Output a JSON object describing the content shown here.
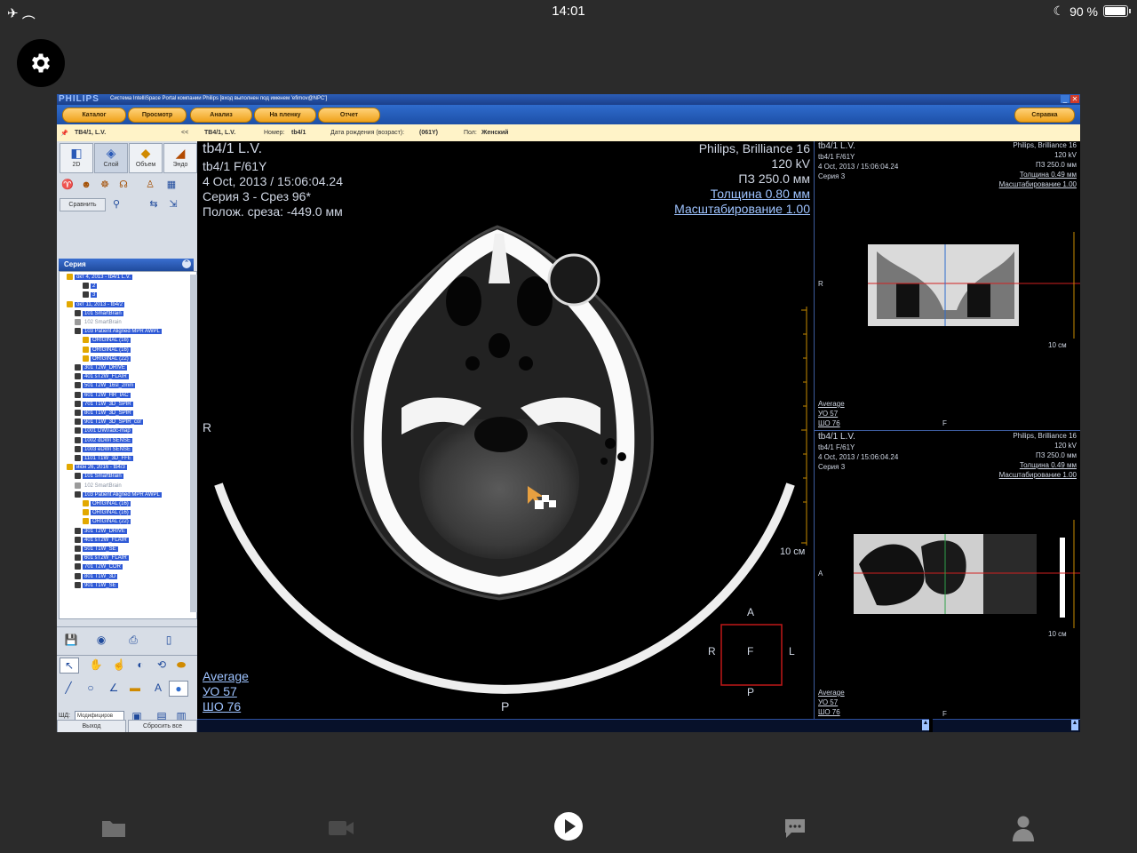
{
  "status_bar": {
    "time": "14:01",
    "battery": "90 %"
  },
  "app": {
    "brand": "PHILIPS",
    "window_title": "Система IntelliSpace Portal компании Philips [вход выполнен под именем 'efimov@NPC']",
    "menu": [
      "Каталог",
      "Просмотр",
      "Анализ",
      "На пленку",
      "Отчет"
    ],
    "help_label": "Справка",
    "info": {
      "patient_tab": "ТВ4/1, L.V.",
      "patient": "ТВ4/1, L.V.",
      "number_label": "Номер:",
      "number": "tb4/1",
      "dob_label": "Дата рождения (возраст):",
      "dob": "(061Y)",
      "sex_label": "Пол:",
      "sex": "Женский"
    },
    "tools": {
      "b2d": "2D",
      "slab": "Слой",
      "volume": "Объем",
      "endo": "Эндо",
      "compare": "Сравнить"
    },
    "series_header": "Серия",
    "series_tree": [
      {
        "label": "окт 4, 2013 - tb4/1 L.V.",
        "indent": 0,
        "dim": false,
        "icon": "#e2a800"
      },
      {
        "label": "2",
        "indent": 2,
        "dim": false,
        "icon": "#3a3a3a"
      },
      {
        "label": "3",
        "indent": 2,
        "dim": false,
        "icon": "#3a3a3a"
      },
      {
        "label": "окт 11, 2013 - tb4/2",
        "indent": 0,
        "dim": false,
        "icon": "#e2a800"
      },
      {
        "label": "101  SmartBrain",
        "indent": 1,
        "dim": false,
        "icon": "#3a3a3a"
      },
      {
        "label": "102  SmartBrain",
        "indent": 1,
        "dim": true,
        "icon": "#9a9a9a"
      },
      {
        "label": "103  Patient Aligned MPR AWPL",
        "indent": 1,
        "dim": false,
        "icon": "#3a3a3a"
      },
      {
        "label": "ORIGINAL (16)",
        "indent": 2,
        "dim": false,
        "icon": "#e2a800"
      },
      {
        "label": "ORIGINAL (16)",
        "indent": 2,
        "dim": false,
        "icon": "#e2a800"
      },
      {
        "label": "ORIGINAL (22)",
        "indent": 2,
        "dim": false,
        "icon": "#e2a800"
      },
      {
        "label": "301  T2W_DRIVE",
        "indent": 1,
        "dim": false,
        "icon": "#3a3a3a"
      },
      {
        "label": "401  sT2W_FLAIR",
        "indent": 1,
        "dim": false,
        "icon": "#3a3a3a"
      },
      {
        "label": "501  T2W_16sl_2mm",
        "indent": 1,
        "dim": false,
        "icon": "#3a3a3a"
      },
      {
        "label": "601  T2W_HR_IAC",
        "indent": 1,
        "dim": false,
        "icon": "#3a3a3a"
      },
      {
        "label": "701  T1W_3D_SPIR",
        "indent": 1,
        "dim": false,
        "icon": "#3a3a3a"
      },
      {
        "label": "801  T1W_3D_SPIR",
        "indent": 1,
        "dim": false,
        "icon": "#3a3a3a"
      },
      {
        "label": "901  T1W_3D_SPIR_cor",
        "indent": 1,
        "dim": false,
        "icon": "#3a3a3a"
      },
      {
        "label": "1001  DWI/adc-map",
        "indent": 1,
        "dim": false,
        "icon": "#3a3a3a"
      },
      {
        "label": "1002  dDWI SENSE",
        "indent": 1,
        "dim": false,
        "icon": "#3a3a3a"
      },
      {
        "label": "1003  eDWI SENSE",
        "indent": 1,
        "dim": false,
        "icon": "#3a3a3a"
      },
      {
        "label": "1101  T1W_3D_FFE",
        "indent": 1,
        "dim": false,
        "icon": "#3a3a3a"
      },
      {
        "label": "июн 26, 2016 - tb4/3",
        "indent": 0,
        "dim": false,
        "icon": "#e2a800"
      },
      {
        "label": "101  SmartBrain",
        "indent": 1,
        "dim": false,
        "icon": "#3a3a3a"
      },
      {
        "label": "102  SmartBrain",
        "indent": 1,
        "dim": true,
        "icon": "#9a9a9a"
      },
      {
        "label": "103  Patient Aligned MPR AWPL",
        "indent": 1,
        "dim": false,
        "icon": "#3a3a3a"
      },
      {
        "label": "ORIGINAL (16)",
        "indent": 2,
        "dim": false,
        "icon": "#e2a800"
      },
      {
        "label": "ORIGINAL (16)",
        "indent": 2,
        "dim": false,
        "icon": "#e2a800"
      },
      {
        "label": "ORIGINAL (22)",
        "indent": 2,
        "dim": false,
        "icon": "#e2a800"
      },
      {
        "label": "301  T2W_DRIVE",
        "indent": 1,
        "dim": false,
        "icon": "#3a3a3a"
      },
      {
        "label": "401  sT2W_FLAIR",
        "indent": 1,
        "dim": false,
        "icon": "#3a3a3a"
      },
      {
        "label": "501  T1W_SE",
        "indent": 1,
        "dim": false,
        "icon": "#3a3a3a"
      },
      {
        "label": "601  sT2W_FLAIR",
        "indent": 1,
        "dim": false,
        "icon": "#3a3a3a"
      },
      {
        "label": "701  T2W_COR",
        "indent": 1,
        "dim": false,
        "icon": "#3a3a3a"
      },
      {
        "label": "801  T1W_3D",
        "indent": 1,
        "dim": false,
        "icon": "#3a3a3a"
      },
      {
        "label": "901  T1W_SE",
        "indent": 1,
        "dim": false,
        "icon": "#3a3a3a"
      }
    ],
    "lower_tools": {
      "shd_label": "ШД:",
      "mode_value": "Модифициров",
      "exit": "Выход",
      "reset_all": "Сбросить все"
    }
  },
  "main_viewer": {
    "patient_name": "tb4/1 L.V.",
    "patient_id": "tb4/1 F/61Y",
    "datetime": "4 Oct, 2013 / 15:06:04.24",
    "series_slice": "Серия 3 - Срез 96*",
    "slice_pos": "Полож. среза: -449.0 мм",
    "scanner": "Philips, Brilliance 16",
    "kv": "120 kV",
    "fov": "ПЗ 250.0 мм",
    "thickness": "Толщина 0.80 мм",
    "zoom": "Масштабирование 1.00",
    "orient_right": "R",
    "orient_bottom": "P",
    "scale_label": "10 см",
    "window_label": "Average",
    "wl": "УО   57",
    "ww": "ШО   76",
    "cube": {
      "top": "A",
      "left": "R",
      "center": "F",
      "right": "L",
      "bottom": "P"
    }
  },
  "side_top": {
    "patient_name": "tb4/1 L.V.",
    "patient_id": "tb4/1 F/61Y",
    "datetime": "4 Oct, 2013 / 15:06:04.24",
    "series": "Серия 3",
    "scanner": "Philips, Brilliance 16",
    "kv": "120 kV",
    "fov": "ПЗ 250.0 мм",
    "thickness": "Толщина 0.49 мм",
    "zoom": "Масштабирование 1.00",
    "orient_left": "R",
    "orient_bottom": "F",
    "scale_label": "10 см",
    "window_label": "Average",
    "wl": "УО   57",
    "ww": "ШО   76"
  },
  "side_bottom": {
    "patient_name": "tb4/1 L.V.",
    "patient_id": "tb4/1 F/61Y",
    "datetime": "4 Oct, 2013 / 15:06:04.24",
    "series": "Серия 3",
    "scanner": "Philips, Brilliance 16",
    "kv": "120 kV",
    "fov": "ПЗ 250.0 мм",
    "thickness": "Толщина 0.49 мм",
    "zoom": "Масштабирование 1.00",
    "orient_left": "A",
    "orient_bottom": "F",
    "scale_label": "10 см",
    "window_label": "Average",
    "wl": "УО   57",
    "ww": "ШО   76"
  },
  "colors": {
    "accent_orange": "#f0a21a",
    "app_blue": "#1f4a9c",
    "overlay_link": "#9ec3ff",
    "crosshair_red": "#d02020",
    "cube_red": "#c01818"
  },
  "icons": {
    "settings": "gear-icon",
    "files": "folder-icon",
    "video": "video-camera-icon",
    "play": "play-icon",
    "chat": "chat-icon",
    "profile": "person-icon"
  }
}
